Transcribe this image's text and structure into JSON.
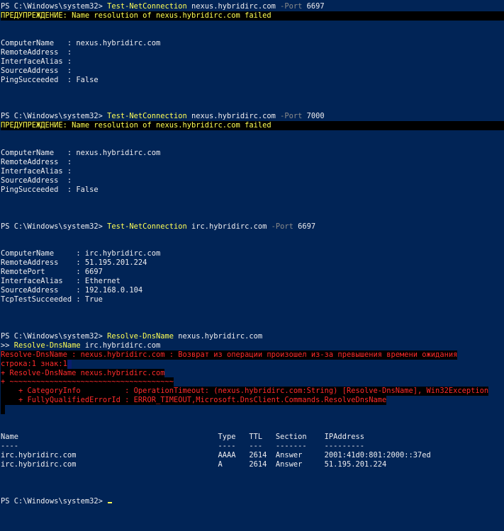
{
  "colors": {
    "background": "#012456",
    "default_text": "#eeedf0",
    "command": "#ffff55",
    "parameter": "#8a8a8a",
    "error": "#ff2b2b",
    "warning_bg": "#000000"
  },
  "lines": [
    {
      "type": "prompt",
      "segments": [
        {
          "t": "PS C:\\Windows\\system32> ",
          "c": "default"
        },
        {
          "t": "Test-NetConnection",
          "c": "cmd"
        },
        {
          "t": " nexus.hybridirc.com ",
          "c": "default"
        },
        {
          "t": "-Port",
          "c": "param"
        },
        {
          "t": " 6697",
          "c": "default"
        }
      ]
    },
    {
      "type": "warning",
      "bar": "full",
      "segments": [
        {
          "t": "ПРЕДУПРЕЖДЕНИЕ: Name resolution of nexus.hybridirc.com failed",
          "c": "warn"
        }
      ]
    },
    {
      "type": "blank",
      "segments": []
    },
    {
      "type": "blank",
      "segments": []
    },
    {
      "type": "output",
      "segments": [
        {
          "t": "ComputerName   : nexus.hybridirc.com",
          "c": "default"
        }
      ]
    },
    {
      "type": "output",
      "segments": [
        {
          "t": "RemoteAddress  :",
          "c": "default"
        }
      ]
    },
    {
      "type": "output",
      "segments": [
        {
          "t": "InterfaceAlias :",
          "c": "default"
        }
      ]
    },
    {
      "type": "output",
      "segments": [
        {
          "t": "SourceAddress  :",
          "c": "default"
        }
      ]
    },
    {
      "type": "output",
      "segments": [
        {
          "t": "PingSucceeded  : False",
          "c": "default"
        }
      ]
    },
    {
      "type": "blank",
      "segments": []
    },
    {
      "type": "blank",
      "segments": []
    },
    {
      "type": "blank",
      "segments": []
    },
    {
      "type": "prompt",
      "segments": [
        {
          "t": "PS C:\\Windows\\system32> ",
          "c": "default"
        },
        {
          "t": "Test-NetConnection",
          "c": "cmd"
        },
        {
          "t": " nexus.hybridirc.com ",
          "c": "default"
        },
        {
          "t": "-Port",
          "c": "param"
        },
        {
          "t": " 7000",
          "c": "default"
        }
      ]
    },
    {
      "type": "warning",
      "bar": "full",
      "segments": [
        {
          "t": "ПРЕДУПРЕЖДЕНИЕ: Name resolution of nexus.hybridirc.com failed",
          "c": "warn"
        }
      ]
    },
    {
      "type": "blank",
      "segments": []
    },
    {
      "type": "blank",
      "segments": []
    },
    {
      "type": "output",
      "segments": [
        {
          "t": "ComputerName   : nexus.hybridirc.com",
          "c": "default"
        }
      ]
    },
    {
      "type": "output",
      "segments": [
        {
          "t": "RemoteAddress  :",
          "c": "default"
        }
      ]
    },
    {
      "type": "output",
      "segments": [
        {
          "t": "InterfaceAlias :",
          "c": "default"
        }
      ]
    },
    {
      "type": "output",
      "segments": [
        {
          "t": "SourceAddress  :",
          "c": "default"
        }
      ]
    },
    {
      "type": "output",
      "segments": [
        {
          "t": "PingSucceeded  : False",
          "c": "default"
        }
      ]
    },
    {
      "type": "blank",
      "segments": []
    },
    {
      "type": "blank",
      "segments": []
    },
    {
      "type": "blank",
      "segments": []
    },
    {
      "type": "prompt",
      "segments": [
        {
          "t": "PS C:\\Windows\\system32> ",
          "c": "default"
        },
        {
          "t": "Test-NetConnection",
          "c": "cmd"
        },
        {
          "t": " irc.hybridirc.com ",
          "c": "default"
        },
        {
          "t": "-Port",
          "c": "param"
        },
        {
          "t": " 6697",
          "c": "default"
        }
      ]
    },
    {
      "type": "blank",
      "segments": []
    },
    {
      "type": "blank",
      "segments": []
    },
    {
      "type": "output",
      "segments": [
        {
          "t": "ComputerName     : irc.hybridirc.com",
          "c": "default"
        }
      ]
    },
    {
      "type": "output",
      "segments": [
        {
          "t": "RemoteAddress    : 51.195.201.224",
          "c": "default"
        }
      ]
    },
    {
      "type": "output",
      "segments": [
        {
          "t": "RemotePort       : 6697",
          "c": "default"
        }
      ]
    },
    {
      "type": "output",
      "segments": [
        {
          "t": "InterfaceAlias   : Ethernet",
          "c": "default"
        }
      ]
    },
    {
      "type": "output",
      "segments": [
        {
          "t": "SourceAddress    : 192.168.0.104",
          "c": "default"
        }
      ]
    },
    {
      "type": "output",
      "segments": [
        {
          "t": "TcpTestSucceeded : True",
          "c": "default"
        }
      ]
    },
    {
      "type": "blank",
      "segments": []
    },
    {
      "type": "blank",
      "segments": []
    },
    {
      "type": "blank",
      "segments": []
    },
    {
      "type": "prompt",
      "segments": [
        {
          "t": "PS C:\\Windows\\system32> ",
          "c": "default"
        },
        {
          "t": "Resolve-DnsName",
          "c": "cmd"
        },
        {
          "t": " nexus.hybridirc.com",
          "c": "default"
        }
      ]
    },
    {
      "type": "prompt",
      "segments": [
        {
          "t": ">> ",
          "c": "default"
        },
        {
          "t": "Resolve-DnsName",
          "c": "cmd"
        },
        {
          "t": " irc.hybridirc.com",
          "c": "default"
        }
      ]
    },
    {
      "type": "error",
      "bar": "inline",
      "segments": [
        {
          "t": "Resolve-DnsName : nexus.hybridirc.com : Возврат из операции произошел из-за превышения времени ожидания",
          "c": "err"
        }
      ]
    },
    {
      "type": "error",
      "bar": "inline",
      "sel_end": true,
      "segments": [
        {
          "t": "строка:1 знак:1",
          "c": "err"
        }
      ]
    },
    {
      "type": "error",
      "bar": "inline",
      "segments": [
        {
          "t": "+ Resolve-DnsName nexus.hybridirc.com",
          "c": "err"
        }
      ]
    },
    {
      "type": "error",
      "bar": "inline",
      "segments": [
        {
          "t": "+ ~~~~~~~~~~~~~~~~~~~~~~~~~~~~~~~~~~~~~",
          "c": "err"
        }
      ]
    },
    {
      "type": "error",
      "bar": "inline",
      "segments": [
        {
          "t": "    + CategoryInfo          : OperationTimeout: (nexus.hybridirc.com:String) [Resolve-DnsName], Win32Exception",
          "c": "err"
        }
      ]
    },
    {
      "type": "error",
      "bar": "inline",
      "segments": [
        {
          "t": "    + FullyQualifiedErrorId : ERROR_TIMEOUT,Microsoft.DnsClient.Commands.ResolveDnsName",
          "c": "err"
        }
      ]
    },
    {
      "type": "error_end",
      "segments": []
    },
    {
      "type": "blank",
      "segments": []
    },
    {
      "type": "blank",
      "segments": []
    },
    {
      "type": "table-header",
      "segments": [
        {
          "t": "Name                                             Type   TTL   Section    IPAddress",
          "c": "default"
        }
      ]
    },
    {
      "type": "table-divider",
      "segments": [
        {
          "t": "----                                             ----   ---   -------    ---------",
          "c": "default"
        }
      ]
    },
    {
      "type": "table-row",
      "segments": [
        {
          "t": "irc.hybridirc.com                                AAAA   2614  Answer     2001:41d0:801:2000::37ed",
          "c": "default"
        }
      ]
    },
    {
      "type": "table-row",
      "segments": [
        {
          "t": "irc.hybridirc.com                                A      2614  Answer     51.195.201.224",
          "c": "default"
        }
      ]
    },
    {
      "type": "blank",
      "segments": []
    },
    {
      "type": "blank",
      "segments": []
    },
    {
      "type": "blank",
      "segments": []
    },
    {
      "type": "prompt-current",
      "segments": [
        {
          "t": "PS C:\\Windows\\system32> ",
          "c": "default"
        }
      ]
    }
  ]
}
